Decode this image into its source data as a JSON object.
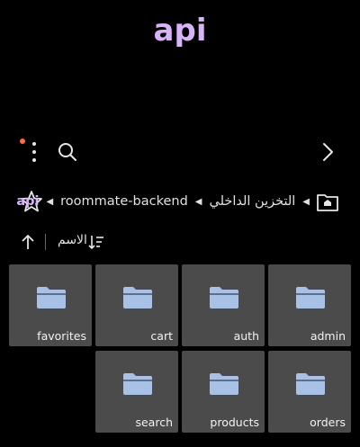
{
  "header": {
    "title": "api"
  },
  "toolbar": {
    "menu_icon": "more-vertical-icon",
    "search_icon": "search-icon",
    "forward_icon": "chevron-right-icon",
    "notification_color": "#ff6b3d"
  },
  "breadcrumb": {
    "items": [
      "api",
      "roommate-backend",
      "التخزين الداخلي"
    ],
    "home_icon": "home-folder-icon",
    "favorite_icon": "star-icon"
  },
  "sort": {
    "label": "الاسم",
    "direction_icon": "arrow-up-icon",
    "order_icon": "sort-order-icon"
  },
  "folders": [
    {
      "name": "admin"
    },
    {
      "name": "auth"
    },
    {
      "name": "cart"
    },
    {
      "name": "favorites"
    },
    {
      "name": "orders"
    },
    {
      "name": "products"
    },
    {
      "name": "search"
    }
  ],
  "colors": {
    "accent": "#d9b3f7",
    "tile_bg": "#4b4b4b",
    "folder_blue": "#a9c1e6"
  }
}
